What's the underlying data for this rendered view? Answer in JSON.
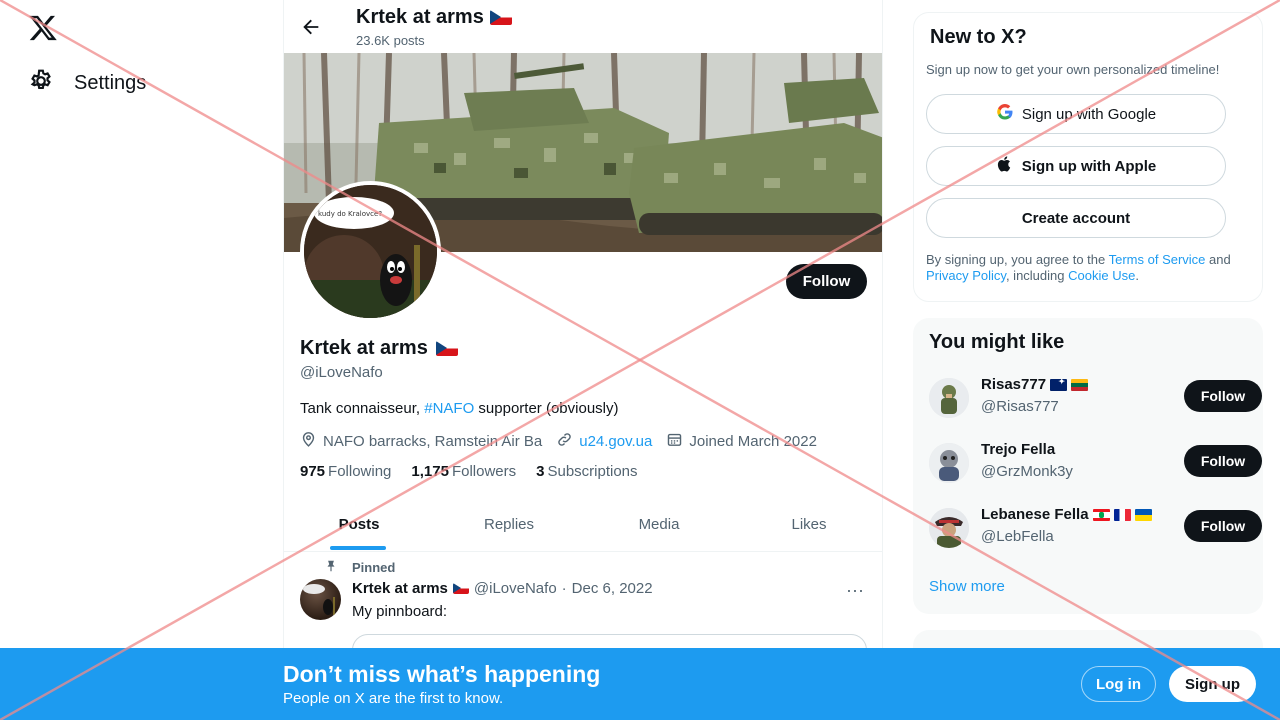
{
  "nav": {
    "settings_label": "Settings",
    "icons": {
      "logo": "x-logo-icon",
      "settings": "gear-icon"
    }
  },
  "profile_header": {
    "name": "Krtek at arms",
    "posts_count": "23.6K posts"
  },
  "banner": {
    "scene": "armored vehicles in forest"
  },
  "avatar": {
    "speech_bubble_text": "kudy do Kralovce?"
  },
  "profile": {
    "follow_label": "Follow",
    "name": "Krtek at arms",
    "handle": "@iLoveNafo",
    "bio_prefix": "Tank connaisseur, ",
    "bio_hashtag": "#NAFO",
    "bio_suffix": " supporter (obviously)",
    "location": "NAFO barracks, Ramstein Air Ba",
    "website": "u24.gov.ua",
    "joined": "Joined March 2022",
    "stats": {
      "following_count": "975",
      "following_label": "Following",
      "followers_count": "1,175",
      "followers_label": "Followers",
      "subscriptions_count": "3",
      "subscriptions_label": "Subscriptions"
    }
  },
  "tabs": [
    {
      "label": "Posts",
      "active": true
    },
    {
      "label": "Replies",
      "active": false
    },
    {
      "label": "Media",
      "active": false
    },
    {
      "label": "Likes",
      "active": false
    }
  ],
  "pinned_post": {
    "pinned_label": "Pinned",
    "author": "Krtek at arms",
    "handle": "@iLoveNafo",
    "separator": "·",
    "date": "Dec 6, 2022",
    "text": "My pinnboard:",
    "more_label": "···"
  },
  "signup_card": {
    "title": "New to X?",
    "subtitle": "Sign up now to get your own personalized timeline!",
    "google_label": "Sign up with Google",
    "apple_label": "Sign up with Apple",
    "create_label": "Create account",
    "terms_prefix": "By signing up, you agree to the ",
    "terms_link": "Terms of Service",
    "terms_and": " and ",
    "privacy_link": "Privacy Policy",
    "terms_mid": ", including ",
    "cookie_link": "Cookie Use",
    "terms_end": "."
  },
  "who_to_follow": {
    "title": "You might like",
    "follow_label": "Follow",
    "show_more": "Show more",
    "accounts": [
      {
        "name": "Risas777",
        "handle": "@Risas777",
        "flags": [
          "flag-au",
          "flag-lt"
        ]
      },
      {
        "name": "Trejo Fella",
        "handle": "@GrzMonk3y",
        "flags": []
      },
      {
        "name": "Lebanese Fella",
        "handle": "@LebFella",
        "flags": [
          "flag-lb",
          "flag-fr",
          "flag-ua"
        ]
      }
    ]
  },
  "bottom_bar": {
    "title": "Don’t miss what’s happening",
    "subtitle": "People on X are the first to know.",
    "login_label": "Log in",
    "signup_label": "Sign up"
  },
  "colors": {
    "accent": "#1d9bf0",
    "text": "#0f1419",
    "muted": "#536471",
    "overlay_x": "#f08a8a"
  }
}
